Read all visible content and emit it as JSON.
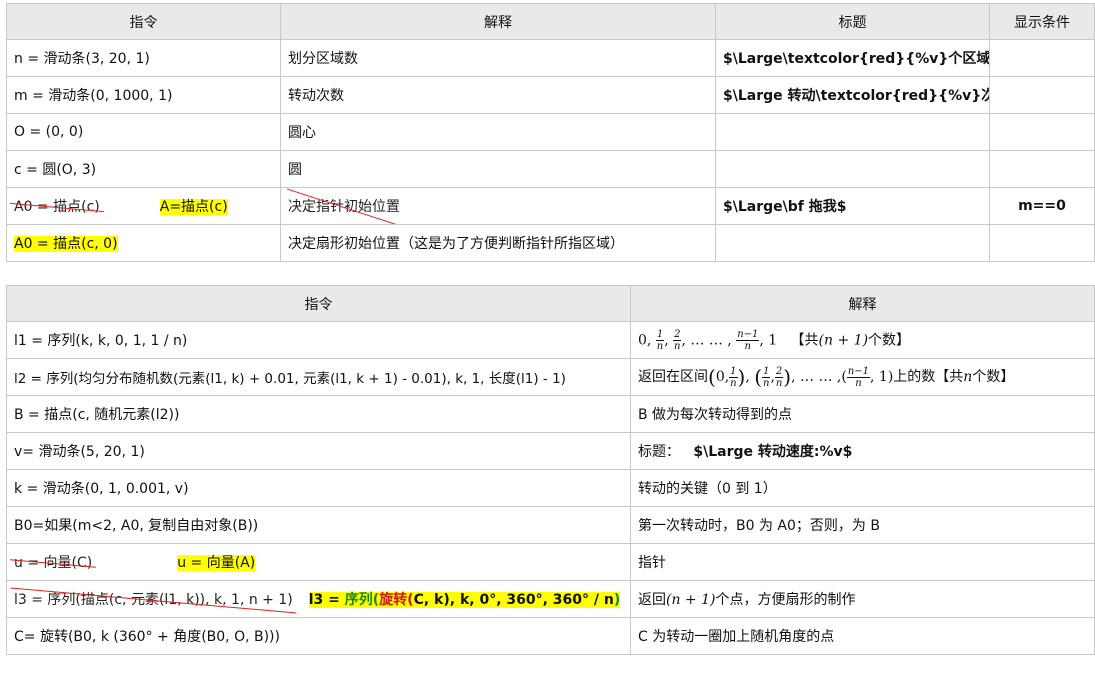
{
  "table1": {
    "headers": [
      "指令",
      "解释",
      "标题",
      "显示条件"
    ],
    "rows": [
      {
        "cmd": "n =  滑动条(3, 20, 1)",
        "explain": "划分区域数",
        "title": "$\\Large\\textcolor{red}{%v}个区域$",
        "cond": ""
      },
      {
        "cmd": "m =  滑动条(0, 1000, 1)",
        "explain": "转动次数",
        "title": "$\\Large 转动\\textcolor{red}{%v}次$",
        "cond": ""
      },
      {
        "cmd": "O = (0, 0)",
        "explain": "圆心",
        "title": "",
        "cond": ""
      },
      {
        "cmd": "c =  圆(O, 3)",
        "explain": "圆",
        "title": "",
        "cond": ""
      },
      {
        "cmd_struck": "A0 =  描点(c)",
        "cmd_new": "A=描点(c)",
        "explain": "决定指针初始位置",
        "title": "$\\Large\\bf 拖我$",
        "cond": "m==0"
      },
      {
        "cmd": "A0 =  描点(c, 0)",
        "explain": "决定扇形初始位置（这是为了方便判断指针所指区域）",
        "title": "",
        "cond": ""
      }
    ]
  },
  "table2": {
    "headers": [
      "指令",
      "解释"
    ],
    "rows": [
      {
        "cmd": "l1 =  序列(k, k, 0, 1, 1 / n)",
        "explain_math": {
          "lead": "0,",
          "f1n": "1",
          "f1d": "n",
          "f2n": "2",
          "f2d": "n",
          "dots": ", … … ,",
          "f3n": "n−1",
          "f3d": "n",
          "tail": ", 1",
          "note_pre": "【共",
          "note_math": "(n + 1)",
          "note_post": "个数】"
        }
      },
      {
        "cmd": "l2 =  序列(均匀分布随机数(元素(l1,  k) + 0.01,  元素(l1, k + 1) - 0.01), k, 1,  长度(l1) - 1)",
        "explain_math": {
          "lead": "返回在区间",
          "tail_text": "上的数【共",
          "n": "n",
          "tail_post": "个数】",
          "dots": ", … … ,"
        }
      },
      {
        "cmd": "B =  描点(c,  随机元素(l2))",
        "explain": "B 做为每次转动得到的点"
      },
      {
        "cmd": "v=  滑动条(5, 20, 1)",
        "explain_label": "标题：",
        "explain_bold": "$\\Large 转动速度:%v$"
      },
      {
        "cmd": "k =  滑动条(0, 1, 0.001, v)",
        "explain": "转动的关键（0 到 1）"
      },
      {
        "cmd": "B0=如果(m<2, A0,  复制自由对象(B))",
        "explain": "第一次转动时，B0 为 A0；否则，为 B"
      },
      {
        "cmd_struck": "u =  向量(C)",
        "cmd_new": "u =  向量(A)",
        "explain": "指针"
      },
      {
        "cmd_struck": "l3 =  序列(描点(c,   元素(l1, k)), k, 1, n + 1)",
        "cmd_new_parts": {
          "a": "l3 = ",
          "b": "序列(",
          "c": "旋转(",
          "d": "C, k",
          "e": "), k, 0°, 360°, 360° / n",
          "f": ")"
        },
        "explain_pre": "返回",
        "explain_math": "(n + 1)",
        "explain_post": "个点，方便扇形的制作"
      },
      {
        "cmd": "C=  旋转(B0, k (360° +  角度(B0, O, B)))",
        "explain": "C 为转动一圈加上随机角度的点"
      }
    ]
  }
}
